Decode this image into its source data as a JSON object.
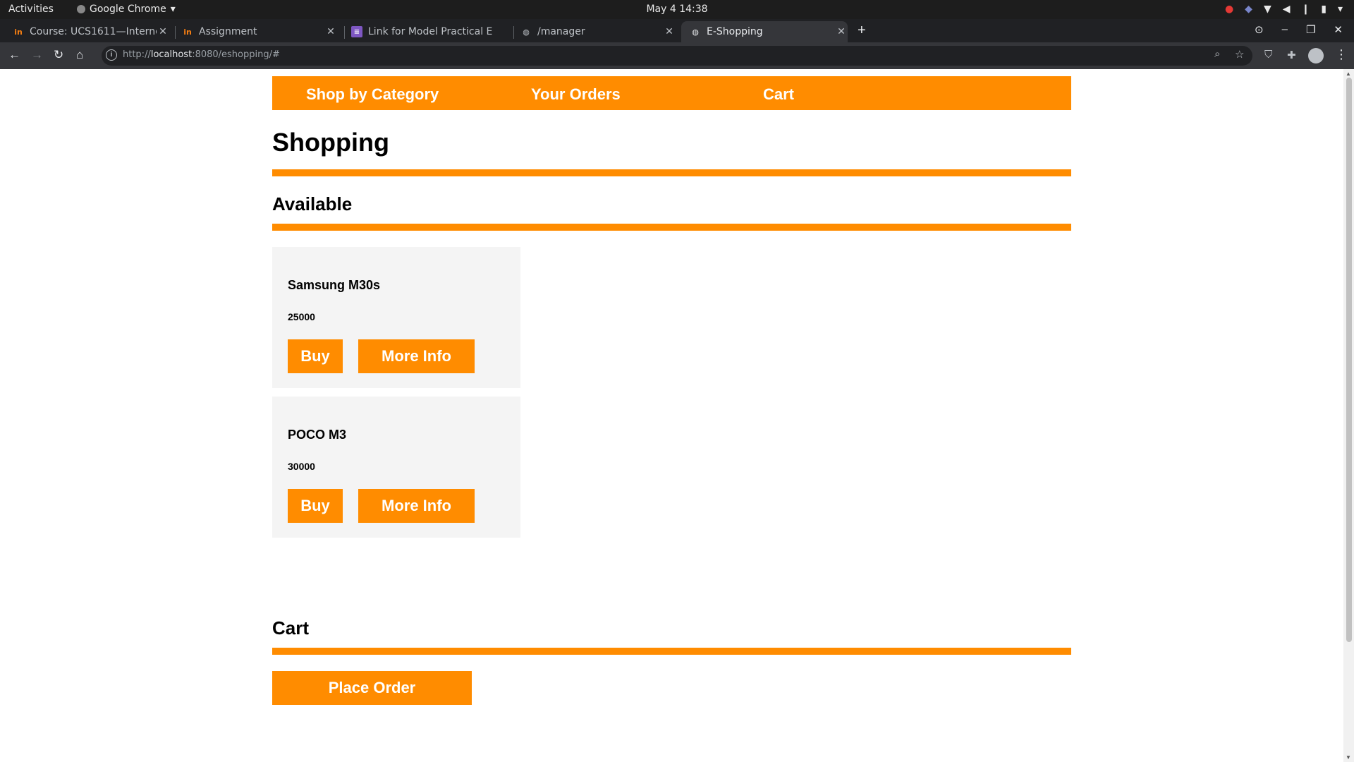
{
  "system_bar": {
    "activities": "Activities",
    "app_name": "Google Chrome",
    "clock": "May 4  14:38"
  },
  "browser": {
    "tabs": [
      {
        "title": "Course: UCS1611—Interne",
        "favicon": "in"
      },
      {
        "title": "Assignment",
        "favicon": "in"
      },
      {
        "title": "Link for Model Practical E",
        "favicon": "doc-icon"
      },
      {
        "title": "/manager",
        "favicon": "globe-icon"
      },
      {
        "title": "E-Shopping",
        "favicon": "globe-icon",
        "active": true
      }
    ],
    "url_scheme": "http://",
    "url_host": "localhost",
    "url_rest": ":8080/eshopping/#"
  },
  "nav": {
    "shop_by_category": "Shop by Category",
    "your_orders": "Your Orders",
    "cart": "Cart"
  },
  "page": {
    "title": "Shopping",
    "available_heading": "Available",
    "cart_heading": "Cart",
    "place_order_label": "Place Order"
  },
  "products": [
    {
      "name": "Samsung M30s",
      "price": "25000",
      "buy_label": "Buy",
      "info_label": "More Info"
    },
    {
      "name": "POCO M3",
      "price": "30000",
      "buy_label": "Buy",
      "info_label": "More Info"
    }
  ],
  "colors": {
    "accent": "#ff8c00",
    "card_bg": "#f4f4f4"
  }
}
